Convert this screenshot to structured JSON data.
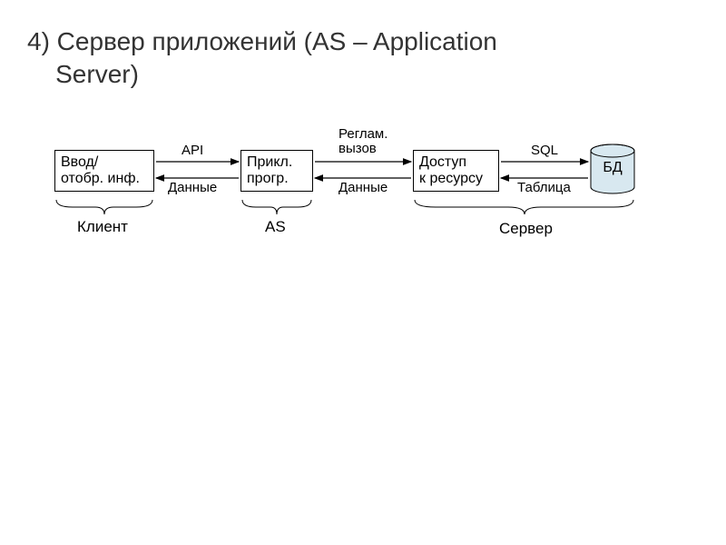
{
  "title_line1": "4)  Сервер приложений (AS – Application",
  "title_line2": "Server)",
  "boxes": {
    "box1_l1": "Ввод/",
    "box1_l2": "отобр. инф.",
    "box2_l1": "Прикл.",
    "box2_l2": "прогр.",
    "box3_l1": "Доступ",
    "box3_l2": "к ресурсу",
    "db": "БД"
  },
  "connections": {
    "c12_top": "API",
    "c12_bot": "Данные",
    "c23_top_l1": "Реглам.",
    "c23_top_l2": "вызов",
    "c23_bot": "Данные",
    "c34_top": "SQL",
    "c34_bot": "Таблица"
  },
  "braces": {
    "b1": "Клиент",
    "b2": "AS",
    "b3": "Сервер"
  }
}
